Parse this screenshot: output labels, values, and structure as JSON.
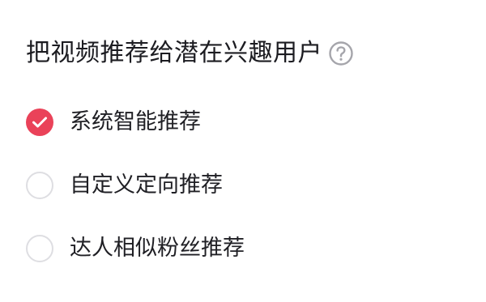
{
  "section": {
    "title": "把视频推荐给潜在兴趣用户",
    "help_icon": "question-circle-icon"
  },
  "options": [
    {
      "label": "系统智能推荐",
      "selected": true
    },
    {
      "label": "自定义定向推荐",
      "selected": false
    },
    {
      "label": "达人相似粉丝推荐",
      "selected": false
    }
  ],
  "colors": {
    "accent": "#ea4259",
    "radio_border": "#dedee2",
    "help_icon": "#a5a5ab",
    "text": "#1f1f24"
  }
}
